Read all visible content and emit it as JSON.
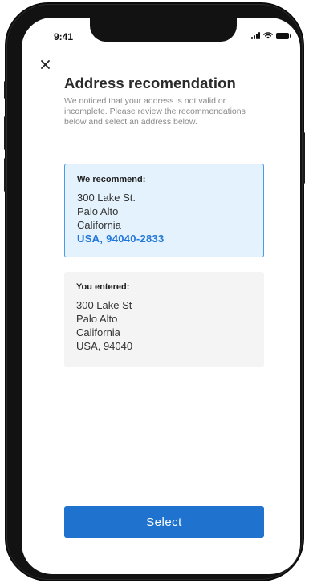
{
  "status_bar": {
    "time": "9:41",
    "icons": [
      "signal-icon",
      "wifi-icon",
      "battery-icon"
    ]
  },
  "header": {
    "close_icon": "close-icon",
    "title": "Address recomendation"
  },
  "description": "We noticed that your address is not valid or incomplete. Please review the recommendations below and select an address below.",
  "recommended": {
    "heading": "We recommend:",
    "street": "300 Lake St.",
    "city": "Palo Alto",
    "state": "California",
    "country_zip": "USA, 94040-2833",
    "selected": true
  },
  "entered": {
    "heading": "You entered:",
    "street": "300 Lake St",
    "city": "Palo Alto",
    "state": "California",
    "country_zip": "USA, 94040"
  },
  "actions": {
    "select_label": "Select"
  },
  "colors": {
    "accent": "#1f73cf",
    "highlight_text": "#2277d8",
    "recommend_bg": "#e3f2fd",
    "recommend_border": "#4a9ae8",
    "entered_bg": "#f4f4f4"
  }
}
